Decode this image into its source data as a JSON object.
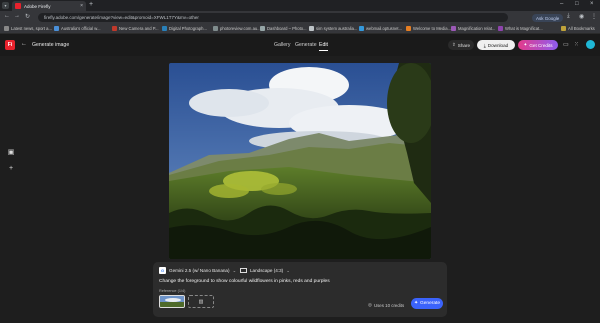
{
  "browser": {
    "tab_title": "Adobe Firefly",
    "close_glyph": "×",
    "newtab_glyph": "+",
    "url": "firefly.adobe.com/generate/image?view=edit&promoid=XFWL1T7Y&mv=other",
    "ask_google_label": "Ask Google",
    "bookmarks": [
      {
        "label": "Latest news, sport a..."
      },
      {
        "label": "Australia's official w..."
      },
      {
        "label": "New Camera and P..."
      },
      {
        "label": "Digital Photograph..."
      },
      {
        "label": "photoreview.com.au..."
      },
      {
        "label": "Dashboard – Photo..."
      },
      {
        "label": "sim system australia..."
      },
      {
        "label": "webmail.optusnet..."
      },
      {
        "label": "Welcome to Media..."
      },
      {
        "label": "Magnification relat..."
      },
      {
        "label": "What is Magnificat..."
      }
    ],
    "all_bookmarks_label": "All Bookmarks"
  },
  "app": {
    "logo_text": "Fi",
    "page_title": "Generate image",
    "mode_tabs": [
      "Gallery",
      "Generate",
      "Edit"
    ],
    "active_tab": "Edit",
    "share_label": "Share",
    "download_label": "Download",
    "get_credits_label": "Get Credits"
  },
  "prompt_panel": {
    "model_label": "Gemini 2.5 (w/ Nano Banana)",
    "aspect_label": "Landscape (4:3)",
    "prompt_text": "Change the foreground to show colourful wildflowers in pinks, reds and purples",
    "reference_label": "Reference (1/4)",
    "uses_credits_label": "Uses 10 credits",
    "generate_label": "Generate"
  },
  "annotation": {
    "arrow_color": "#e0201c"
  },
  "colors": {
    "accent_blue": "#3b63fb",
    "brand_red": "#e8222d"
  }
}
